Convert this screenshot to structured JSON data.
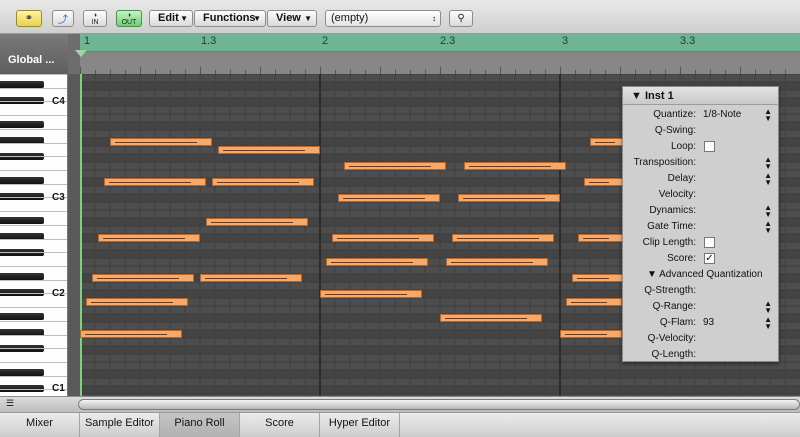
{
  "toolbar": {
    "edit_label": "Edit",
    "functions_label": "Functions",
    "view_label": "View",
    "region_select_value": "(empty)",
    "in_label": "IN",
    "out_label": "OUT",
    "icons": [
      "link-icon",
      "pointer-icon",
      "midi-in-icon",
      "midi-out-icon",
      "search-icon"
    ]
  },
  "global_tracks": {
    "label": "Global ..."
  },
  "ruler": {
    "labels": [
      "1",
      "1.3",
      "2",
      "2.3",
      "3",
      "3.3"
    ]
  },
  "keyboard": {
    "octave_labels": [
      "C4",
      "C3",
      "C2",
      "C1"
    ]
  },
  "panel": {
    "title": "Inst 1",
    "rows": [
      {
        "label": "Quantize:",
        "value": "1/8-Note",
        "stepper": true
      },
      {
        "label": "Q-Swing:",
        "value": "",
        "stepper": false
      },
      {
        "label": "Loop:",
        "checkbox": false
      },
      {
        "label": "Transposition:",
        "value": "",
        "stepper": true
      },
      {
        "label": "Delay:",
        "value": "",
        "stepper": true
      },
      {
        "label": "Velocity:",
        "value": "",
        "stepper": false
      },
      {
        "label": "Dynamics:",
        "value": "",
        "stepper": true
      },
      {
        "label": "Gate Time:",
        "value": "",
        "stepper": true
      },
      {
        "label": "Clip Length:",
        "checkbox": false
      },
      {
        "label": "Score:",
        "checkbox": true
      }
    ],
    "advanced_label": "Advanced Quantization",
    "advanced_rows": [
      {
        "label": "Q-Strength:",
        "value": "",
        "stepper": false
      },
      {
        "label": "Q-Range:",
        "value": "",
        "stepper": true
      },
      {
        "label": "Q-Flam:",
        "value": "93",
        "stepper": true
      },
      {
        "label": "Q-Velocity:",
        "value": "",
        "stepper": false
      },
      {
        "label": "Q-Length:",
        "value": "",
        "stepper": false
      }
    ]
  },
  "tabs": [
    "Mixer",
    "Sample Editor",
    "Piano Roll",
    "Score",
    "Hyper Editor"
  ],
  "active_tab": "Piano Roll",
  "colors": {
    "note_fill": "#f7a96a",
    "cycle_bar": "#6fb493",
    "playhead": "#7fcf7f",
    "grid_bg": "#4a4a4a"
  }
}
